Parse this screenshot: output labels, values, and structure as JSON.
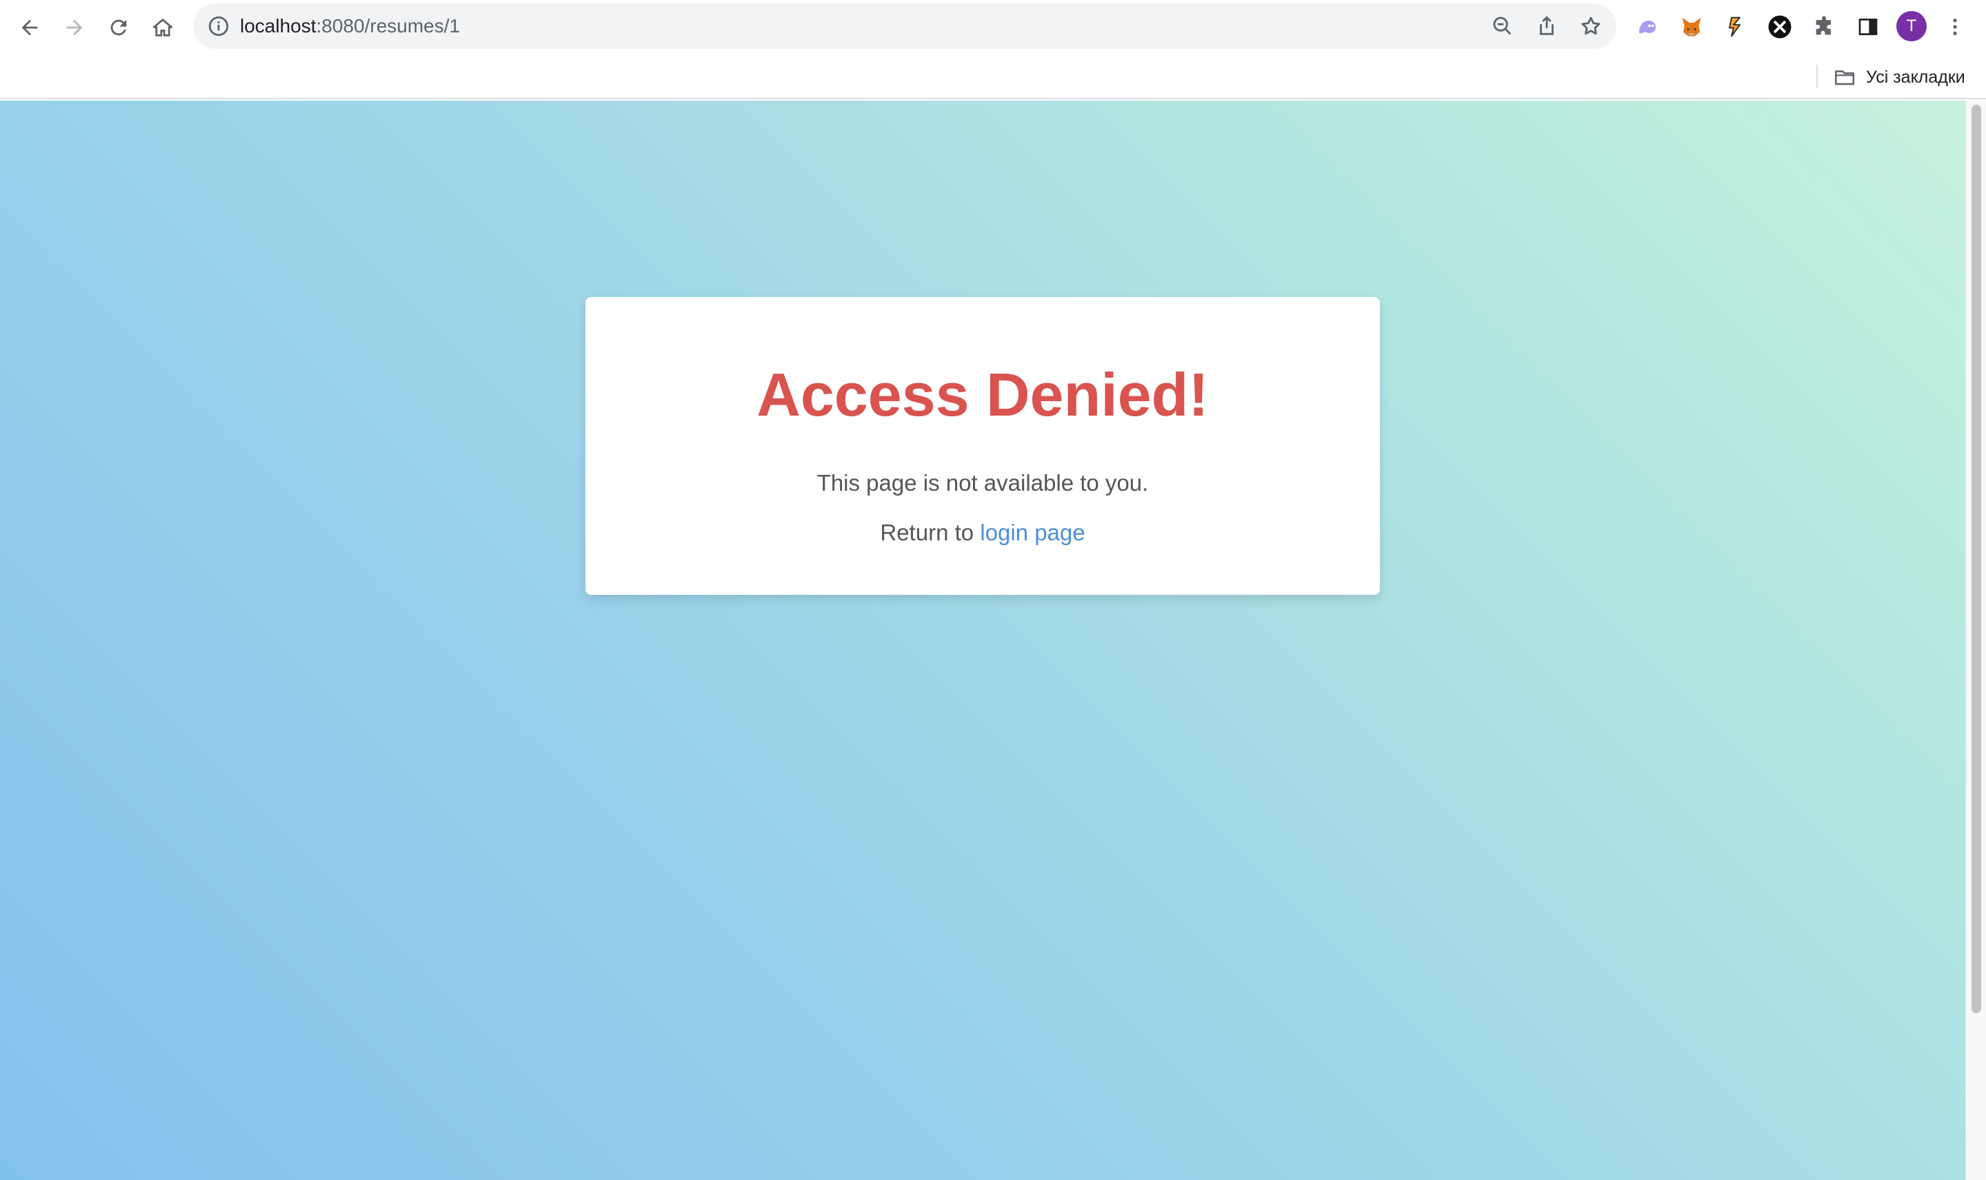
{
  "browser": {
    "url_host": "localhost",
    "url_rest": ":8080/resumes/1",
    "avatar_letter": "T",
    "bookmarks_folder": "Усі закладки",
    "icons": {
      "back": "back-arrow-icon",
      "forward": "forward-arrow-icon",
      "reload": "reload-icon",
      "home": "home-icon",
      "info": "info-icon",
      "zoom": "zoom-out-icon",
      "share": "share-icon",
      "bookmark": "star-icon",
      "extensions": [
        "ghost-extension-icon",
        "metamask-fox-icon",
        "coin-extension-icon",
        "x-extension-icon",
        "puzzle-icon"
      ],
      "side_panel": "side-panel-icon",
      "menu": "kebab-menu-icon"
    },
    "colors": {
      "avatar": "#7b2fa6"
    }
  },
  "page": {
    "heading": "Access Denied!",
    "message": "This page is not available to you.",
    "return_text": "Return to ",
    "login_link": "login page",
    "colors": {
      "heading": "#d9534f",
      "link": "#4a90d9",
      "text": "#555555",
      "gradient_start": "#84c2ee",
      "gradient_end": "#c7f2de"
    }
  }
}
